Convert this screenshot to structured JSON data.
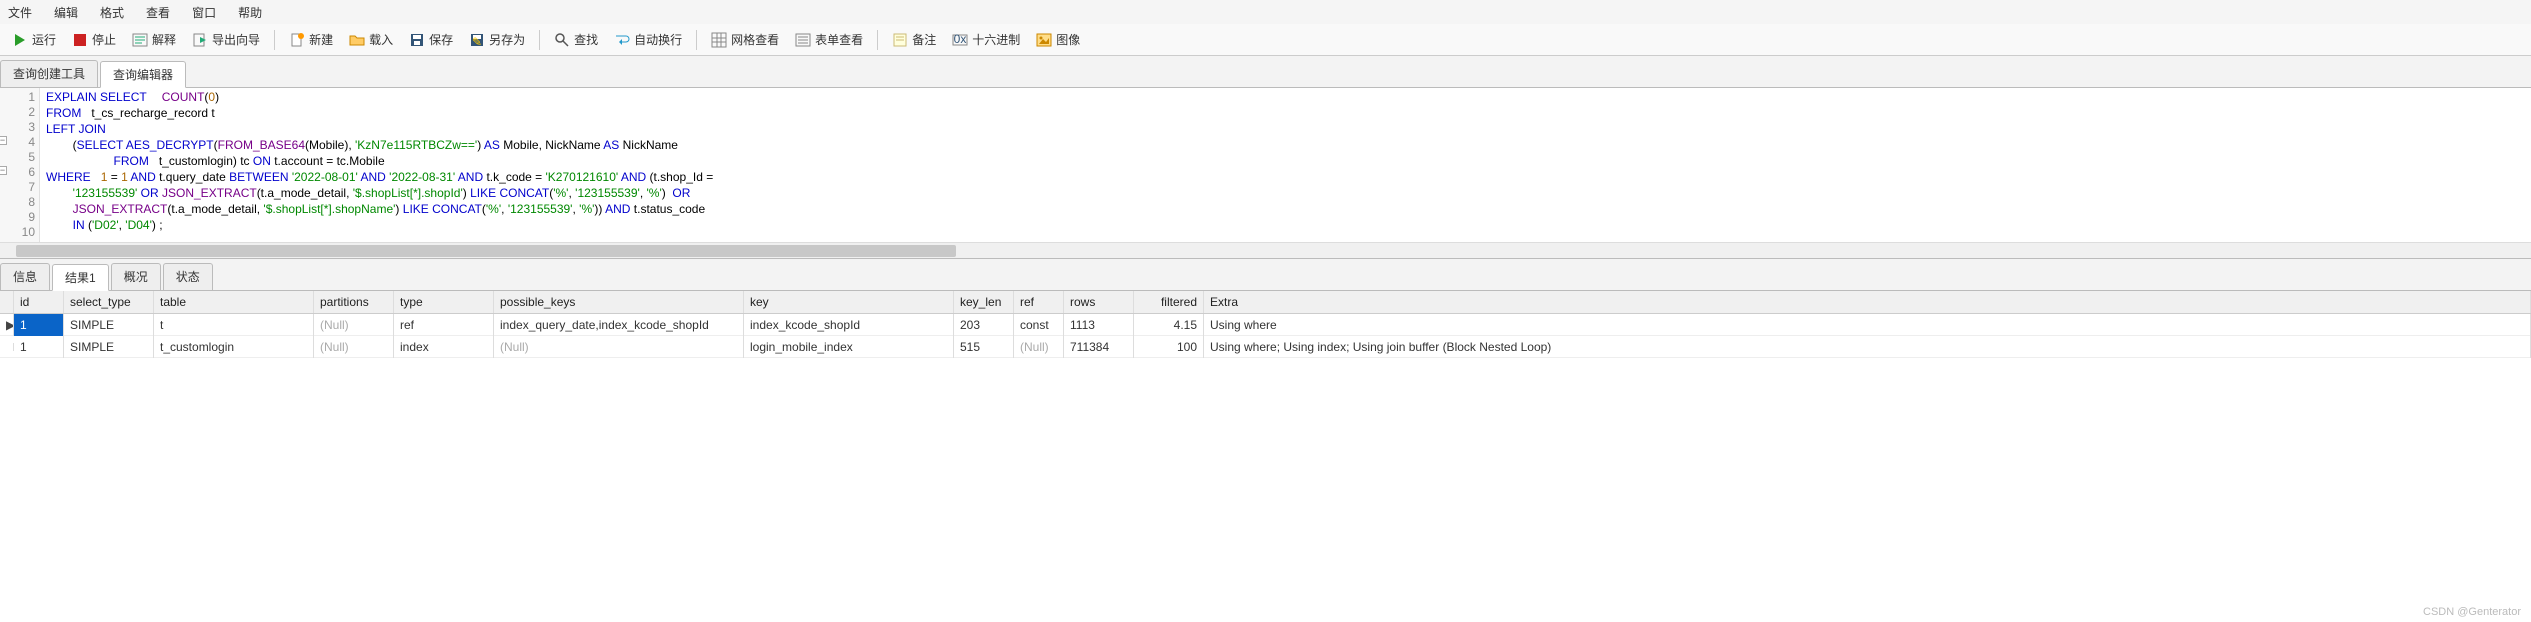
{
  "menu": {
    "items": [
      "文件",
      "编辑",
      "格式",
      "查看",
      "窗口",
      "帮助"
    ]
  },
  "toolbar": {
    "run": "运行",
    "stop": "停止",
    "explain": "解释",
    "export": "导出向导",
    "new": "新建",
    "load": "载入",
    "save": "保存",
    "saveas": "另存为",
    "find": "查找",
    "autowrap": "自动换行",
    "gridview": "网格查看",
    "formview": "表单查看",
    "note": "备注",
    "hex": "十六进制",
    "image": "图像"
  },
  "tabs_top": {
    "builder": "查询创建工具",
    "editor": "查询编辑器"
  },
  "code": {
    "l1_a": "EXPLAIN SELECT",
    "l1_b": "COUNT",
    "l1_c": "(",
    "l1_d": "0",
    "l1_e": ")",
    "l2_a": "FROM",
    "l2_b": "   t_cs_recharge_record t",
    "l3_a": "LEFT JOIN",
    "l4_a": "        (",
    "l4_b": "SELECT AES_DECRYPT",
    "l4_c": "(",
    "l4_d": "FROM_BASE64",
    "l4_e": "(Mobile), ",
    "l4_f": "'KzN7e115RTBCZw=='",
    "l4_g": ") ",
    "l4_h": "AS",
    "l4_i": " Mobile, NickName ",
    "l4_j": "AS",
    "l4_k": " NickName",
    "l5_a": "FROM",
    "l5_b": "   t_customlogin) tc ",
    "l5_c": "ON",
    "l5_d": " t.account = tc.Mobile",
    "l6_a": "WHERE",
    "l6_b": "   ",
    "l6_c": "1",
    "l6_d": " = ",
    "l6_e": "1",
    "l6_f": " AND",
    "l6_g": " t.query_date ",
    "l6_h": "BETWEEN",
    "l6_i": " ",
    "l6_j": "'2022-08-01'",
    "l6_k": " AND ",
    "l6_l": "'2022-08-31'",
    "l6_m": " AND",
    "l6_n": " t.k_code = ",
    "l6_o": "'K270121610'",
    "l6_p": " AND",
    "l6_q": " (t.shop_Id =",
    "l7_a": "        ",
    "l7_b": "'123155539'",
    "l7_c": " OR",
    "l7_d": " JSON_EXTRACT",
    "l7_e": "(t.a_mode_detail, ",
    "l7_f": "'$.shopList[*].shopId'",
    "l7_g": ") ",
    "l7_h": "LIKE CONCAT",
    "l7_i": "(",
    "l7_j": "'%'",
    "l7_k": ", ",
    "l7_l": "'123155539'",
    "l7_m": ", ",
    "l7_n": "'%'",
    "l7_o": ")  ",
    "l7_p": "OR",
    "l8_a": "        ",
    "l8_b": "JSON_EXTRACT",
    "l8_c": "(t.a_mode_detail, ",
    "l8_d": "'$.shopList[*].shopName'",
    "l8_e": ") ",
    "l8_f": "LIKE CONCAT",
    "l8_g": "(",
    "l8_h": "'%'",
    "l8_i": ", ",
    "l8_j": "'123155539'",
    "l8_k": ", ",
    "l8_l": "'%'",
    "l8_m": ")) ",
    "l8_n": "AND",
    "l8_o": " t.status_code",
    "l9_a": "        ",
    "l9_b": "IN",
    "l9_c": " (",
    "l9_d": "'D02'",
    "l9_e": ", ",
    "l9_f": "'D04'",
    "l9_g": ") ;"
  },
  "tabs_bottom": {
    "info": "信息",
    "result": "结果1",
    "profile": "概况",
    "status": "状态"
  },
  "grid": {
    "headers": {
      "id": "id",
      "st": "select_type",
      "tbl": "table",
      "part": "partitions",
      "type": "type",
      "pk": "possible_keys",
      "key": "key",
      "kl": "key_len",
      "ref": "ref",
      "rows": "rows",
      "filt": "filtered",
      "extra": "Extra"
    },
    "rows": [
      {
        "id": "1",
        "st": "SIMPLE",
        "tbl": "t",
        "part": "(Null)",
        "type": "ref",
        "pk": "index_query_date,index_kcode_shopId",
        "key": "index_kcode_shopId",
        "kl": "203",
        "ref": "const",
        "rows": "1113",
        "filt": "4.15",
        "extra": "Using where"
      },
      {
        "id": "1",
        "st": "SIMPLE",
        "tbl": "t_customlogin",
        "part": "(Null)",
        "type": "index",
        "pk": "(Null)",
        "key": "login_mobile_index",
        "kl": "515",
        "ref": "(Null)",
        "rows": "711384",
        "filt": "100",
        "extra": "Using where; Using index; Using join buffer (Block Nested Loop)"
      }
    ]
  },
  "watermark": "CSDN @Genterator"
}
